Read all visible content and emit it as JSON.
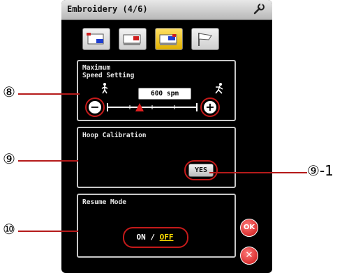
{
  "title": "Embroidery (4/6)",
  "tabs": [
    {
      "icon": "embroidery-frame-icon",
      "active": false
    },
    {
      "icon": "embroidery-machine-icon",
      "active": false
    },
    {
      "icon": "embroidery-machine-highlight-icon",
      "active": true
    },
    {
      "icon": "flag-icon",
      "active": false
    }
  ],
  "speed": {
    "label_line1": "Maximum",
    "label_line2": "Speed Setting",
    "value": "600 spm",
    "minus": "−",
    "plus": "+",
    "slow_icon": "walking-person-icon",
    "fast_icon": "running-person-icon"
  },
  "hoop": {
    "label": "Hoop Calibration",
    "button": "YES"
  },
  "resume": {
    "label": "Resume Mode",
    "on": "ON",
    "sep": " / ",
    "off": "OFF"
  },
  "ok_label": "OK",
  "close_label": "✕",
  "callouts": {
    "c8": "⑧",
    "c9": "⑨",
    "c9_1_num": "⑨",
    "c9_1_suffix": "-1",
    "c10": "⑩"
  },
  "colors": {
    "callout_red": "#c41a1a",
    "active_tab": "#f0c000",
    "off_text": "#ffe000"
  }
}
